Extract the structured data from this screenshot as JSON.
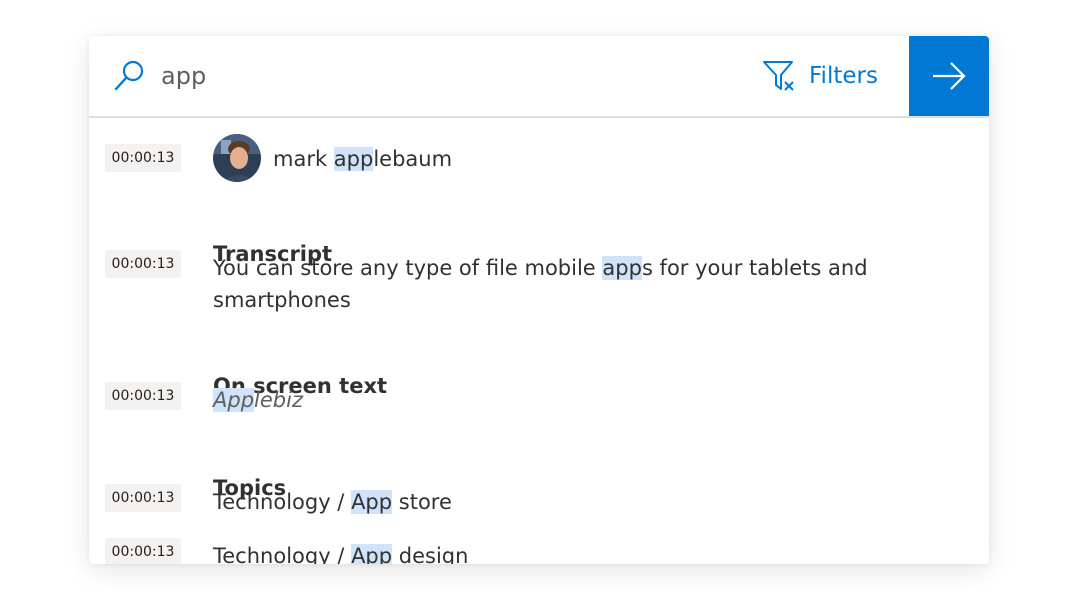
{
  "search": {
    "value": "app",
    "placeholder": ""
  },
  "filters": {
    "label": "Filters"
  },
  "icons": {
    "search": "search-icon",
    "filter": "filter-clear-icon",
    "go": "arrow-right-icon"
  },
  "colors": {
    "accent": "#0078d4",
    "highlight": "#cfe4fa",
    "timestamp_bg": "#f3f2f1"
  },
  "results": {
    "person": {
      "timestamp": "00:00:13",
      "name_pre": "mark ",
      "name_match": "app",
      "name_post": "lebaum"
    },
    "transcript": {
      "title": "Transcript",
      "timestamp": "00:00:13",
      "text_pre": "You can store any type of file mobile ",
      "text_match": "app",
      "text_line1_post": "s for your tablets and",
      "text_line2": "smartphones"
    },
    "onscreen": {
      "title": "On screen text",
      "timestamp": "00:00:13",
      "match": "App",
      "post": "lebiz"
    },
    "topics": {
      "title": "Topics",
      "items": [
        {
          "timestamp": "00:00:13",
          "pre": "Technology / ",
          "match": "App",
          "post": " store"
        },
        {
          "timestamp": "00:00:13",
          "pre": "Technology / ",
          "match": "App",
          "post": " design"
        }
      ]
    }
  }
}
